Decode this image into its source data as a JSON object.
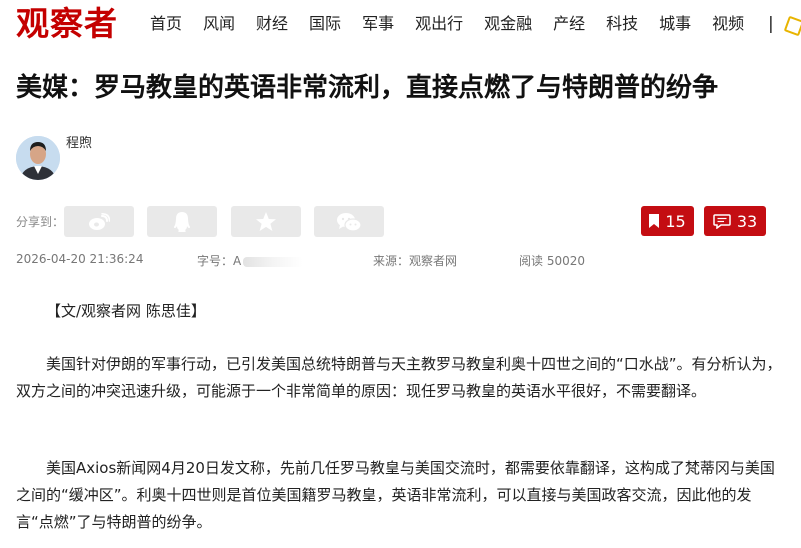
{
  "nav": {
    "logo": "观察者",
    "items": [
      "首页",
      "风闻",
      "财经",
      "国际",
      "军事",
      "观出行",
      "观金融",
      "产经",
      "科技",
      "城事",
      "视频"
    ],
    "divider": "|",
    "extra_icon": "diamond-icon"
  },
  "article": {
    "title": "美媒：罗马教皇的英语非常流利，直接点燃了与特朗普的纷争",
    "author": "程煦",
    "share_label": "分享到：",
    "share_icons": [
      "weibo-icon",
      "qq-icon",
      "star-icon",
      "wechat-icon"
    ],
    "bookmark_count": "15",
    "comment_count": "33",
    "meta": {
      "datetime": "2026-04-20 21:36:24",
      "wordcount_label": "字号：",
      "wordcount_value": "A",
      "source": "来源：观察者网",
      "reads": "阅读 50020"
    },
    "paragraphs": [
      "【文/观察者网 陈思佳】",
      "美国针对伊朗的军事行动，已引发美国总统特朗普与天主教罗马教皇利奥十四世之间的“口水战”。有分析认为，双方之间的冲突迅速升级，可能源于一个非常简单的原因：现任罗马教皇的英语水平很好，不需要翻译。",
      "美国Axios新闻网4月20日发文称，先前几任罗马教皇与美国交流时，都需要依靠翻译，这构成了梵蒂冈与美国之间的“缓冲区”。利奥十四世则是首位美国籍罗马教皇，英语非常流利，可以直接与美国政客交流，因此他的发言“点燃”了与特朗普的纷争。"
    ]
  },
  "colors": {
    "brand": "#c40000",
    "action": "#c40d12",
    "share_bg": "#e9e9e9"
  }
}
